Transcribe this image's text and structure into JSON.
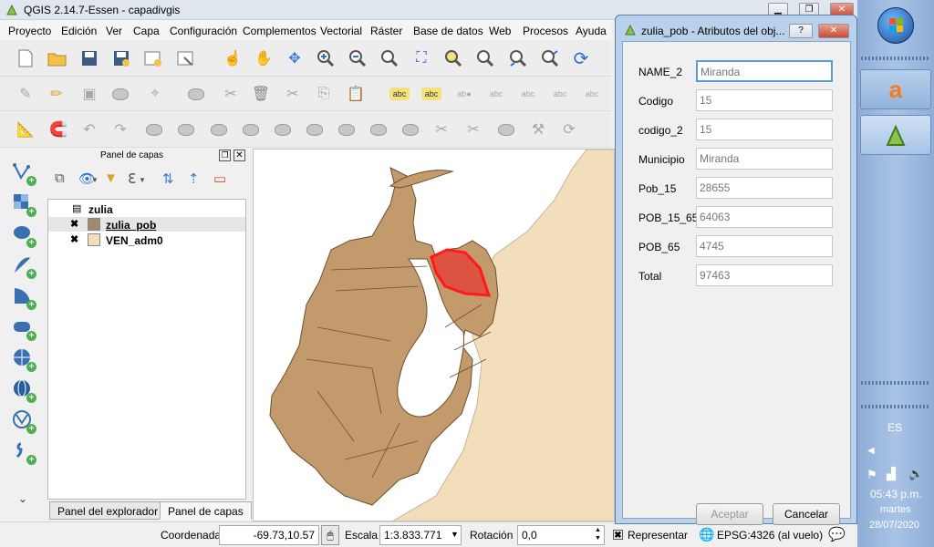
{
  "window": {
    "title": "QGIS 2.14.7-Essen - capadivgis"
  },
  "menu": [
    "Proyecto",
    "Edición",
    "Ver",
    "Capa",
    "Configuración",
    "Complementos",
    "Vectorial",
    "Ráster",
    "Base de datos",
    "Web",
    "Procesos",
    "Ayuda"
  ],
  "layers_panel": {
    "title": "Panel de capas",
    "group": "zulia",
    "layers": [
      {
        "name": "zulia_pob",
        "checked": true,
        "color": "#a08a6c"
      },
      {
        "name": "VEN_adm0",
        "checked": true,
        "color": "#f3debb"
      }
    ],
    "tabs": [
      "Panel del explorador",
      "Panel de capas"
    ]
  },
  "status": {
    "coord_label": "Coordenada",
    "coord_value": "-69.73,10.57",
    "scale_label": "Escala",
    "scale_value": "1:3.833.771",
    "rotation_label": "Rotación",
    "rotation_value": "0,0",
    "render_label": "Representar",
    "crs": "EPSG:4326 (al vuelo)"
  },
  "dialog": {
    "title": "zulia_pob - Atributos del obj...",
    "fields": [
      {
        "label": "NAME_2",
        "value": "Miranda"
      },
      {
        "label": "Codigo",
        "value": "15"
      },
      {
        "label": "codigo_2",
        "value": "15"
      },
      {
        "label": "Municipio",
        "value": "Miranda"
      },
      {
        "label": "Pob_15",
        "value": "28655"
      },
      {
        "label": "POB_15_65",
        "value": "64063"
      },
      {
        "label": "POB_65",
        "value": "4745"
      },
      {
        "label": "Total",
        "value": "97463"
      }
    ],
    "accept": "Aceptar",
    "cancel": "Cancelar"
  },
  "taskbar": {
    "lang": "ES",
    "time": "05:43 p.m.",
    "day": "martes",
    "date": "28/07/2020"
  },
  "colors": {
    "municipality": "#c39a6b",
    "highlight": "#e0483a",
    "background_land": "#f3debb"
  }
}
